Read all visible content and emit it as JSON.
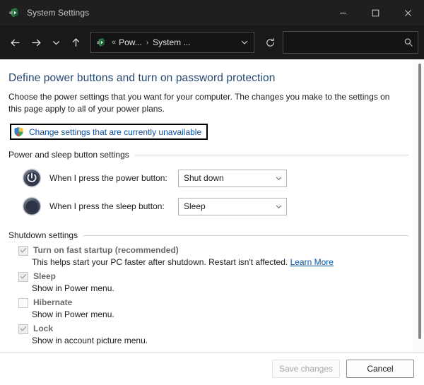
{
  "window": {
    "title": "System Settings",
    "app_icon": "system-settings-icon",
    "controls": {
      "minimize": "minimize-icon",
      "maximize": "maximize-icon",
      "close": "close-icon"
    }
  },
  "nav": {
    "back": "back-arrow-icon",
    "forward": "forward-arrow-icon",
    "recent": "chevron-down-icon",
    "up": "up-arrow-icon",
    "refresh": "refresh-icon",
    "breadcrumb": {
      "icon": "control-panel-icon",
      "overflow": "«",
      "items": [
        "Pow...",
        "System ..."
      ],
      "separator": "›",
      "dropdown": "chevron-down-icon"
    }
  },
  "search": {
    "value": "",
    "placeholder": "",
    "icon": "search-icon"
  },
  "main": {
    "title": "Define power buttons and turn on password protection",
    "description": "Choose the power settings that you want for your computer. The changes you make to the settings on this page apply to all of your power plans.",
    "uac_link": {
      "label": "Change settings that are currently unavailable",
      "icon": "uac-shield-icon",
      "highlighted": true
    },
    "power_section": {
      "title": "Power and sleep button settings",
      "rows": [
        {
          "icon": "power-button-icon",
          "label": "When I press the power button:",
          "value": "Shut down"
        },
        {
          "icon": "sleep-button-icon",
          "label": "When I press the sleep button:",
          "value": "Sleep"
        }
      ]
    },
    "shutdown_section": {
      "title": "Shutdown settings",
      "items": [
        {
          "label": "Turn on fast startup (recommended)",
          "checked": true,
          "disabled": true,
          "desc_before": "This helps start your PC faster after shutdown. Restart isn't affected.",
          "link": "Learn More"
        },
        {
          "label": "Sleep",
          "checked": true,
          "disabled": true,
          "desc_before": "Show in Power menu.",
          "link": ""
        },
        {
          "label": "Hibernate",
          "checked": false,
          "disabled": true,
          "desc_before": "Show in Power menu.",
          "link": ""
        },
        {
          "label": "Lock",
          "checked": true,
          "disabled": true,
          "desc_before": "Show in account picture menu.",
          "link": ""
        }
      ]
    }
  },
  "footer": {
    "save_label": "Save changes",
    "save_disabled": true,
    "cancel_label": "Cancel"
  },
  "colors": {
    "titlebar_bg": "#1f1f1f",
    "navbar_bg": "#191919",
    "heading": "#26486f",
    "link": "#0b4f9e",
    "highlight_border": "#000000"
  }
}
